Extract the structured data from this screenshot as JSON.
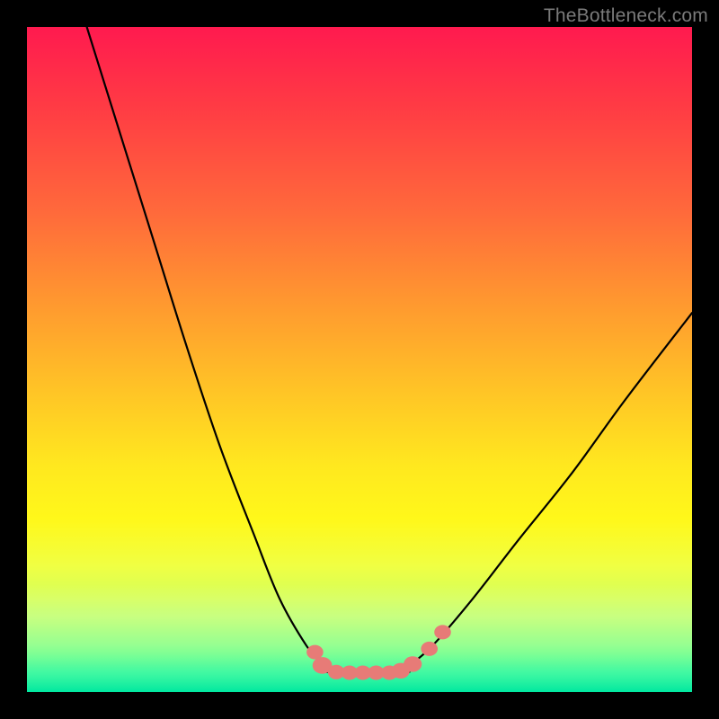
{
  "watermark": "TheBottleneck.com",
  "chart_data": {
    "type": "line",
    "title": "",
    "xlabel": "",
    "ylabel": "",
    "xlim": [
      0,
      100
    ],
    "ylim": [
      0,
      100
    ],
    "grid": false,
    "legend": false,
    "series": [
      {
        "name": "left-branch",
        "x": [
          9,
          14,
          19,
          24,
          29,
          34,
          38,
          42,
          44.5
        ],
        "values": [
          100,
          84,
          68,
          52,
          37,
          24,
          14,
          7,
          4
        ]
      },
      {
        "name": "right-branch",
        "x": [
          57.5,
          61,
          67,
          74,
          82,
          90,
          100
        ],
        "values": [
          4,
          7,
          14,
          23,
          33,
          44,
          57
        ]
      },
      {
        "name": "floor-segment",
        "x": [
          44.5,
          57.5
        ],
        "values": [
          3,
          3
        ]
      }
    ],
    "markers": {
      "name": "salmon-dots",
      "color": "#e77b77",
      "points": [
        {
          "x": 43.3,
          "y": 6.0,
          "r": 1.2
        },
        {
          "x": 44.4,
          "y": 4.0,
          "r": 1.4
        },
        {
          "x": 46.5,
          "y": 3.0,
          "r": 1.2
        },
        {
          "x": 48.5,
          "y": 2.9,
          "r": 1.2
        },
        {
          "x": 50.5,
          "y": 2.9,
          "r": 1.2
        },
        {
          "x": 52.5,
          "y": 2.9,
          "r": 1.2
        },
        {
          "x": 54.5,
          "y": 2.9,
          "r": 1.2
        },
        {
          "x": 56.2,
          "y": 3.2,
          "r": 1.3
        },
        {
          "x": 58.0,
          "y": 4.2,
          "r": 1.3
        },
        {
          "x": 60.5,
          "y": 6.5,
          "r": 1.2
        },
        {
          "x": 62.5,
          "y": 9.0,
          "r": 1.2
        }
      ]
    },
    "background_gradient": {
      "top": "#ff1a4f",
      "mid": "#ffe81f",
      "bottom": "#00e8a0"
    }
  }
}
